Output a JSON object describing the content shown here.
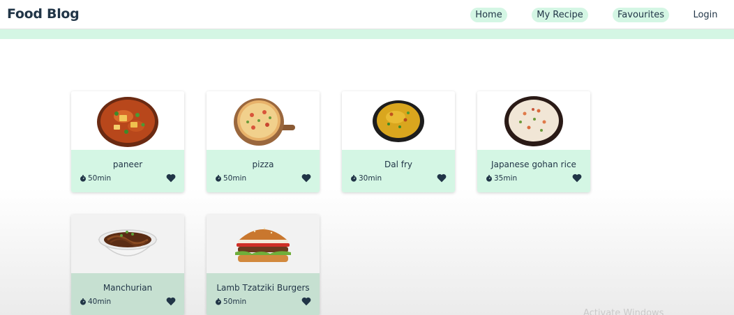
{
  "header": {
    "brand": "Food Blog",
    "nav": {
      "home": "Home",
      "my_recipe": "My Recipe",
      "favourites": "Favourites",
      "login": "Login"
    }
  },
  "recipes": [
    {
      "title": "paneer",
      "time": "50min",
      "image": "curry-bowl"
    },
    {
      "title": "pizza",
      "time": "50min",
      "image": "pizza-board"
    },
    {
      "title": "Dal fry",
      "time": "30min",
      "image": "dal-bowl"
    },
    {
      "title": "Japanese gohan rice",
      "time": "35min",
      "image": "rice-bowl"
    },
    {
      "title": "Manchurian",
      "time": "40min",
      "image": "noodle-bowl"
    },
    {
      "title": "Lamb Tzatziki Burgers",
      "time": "50min",
      "image": "burger"
    }
  ],
  "watermark": "Activate Windows",
  "colors": {
    "accent": "#d4f6e4",
    "text": "#213547"
  }
}
